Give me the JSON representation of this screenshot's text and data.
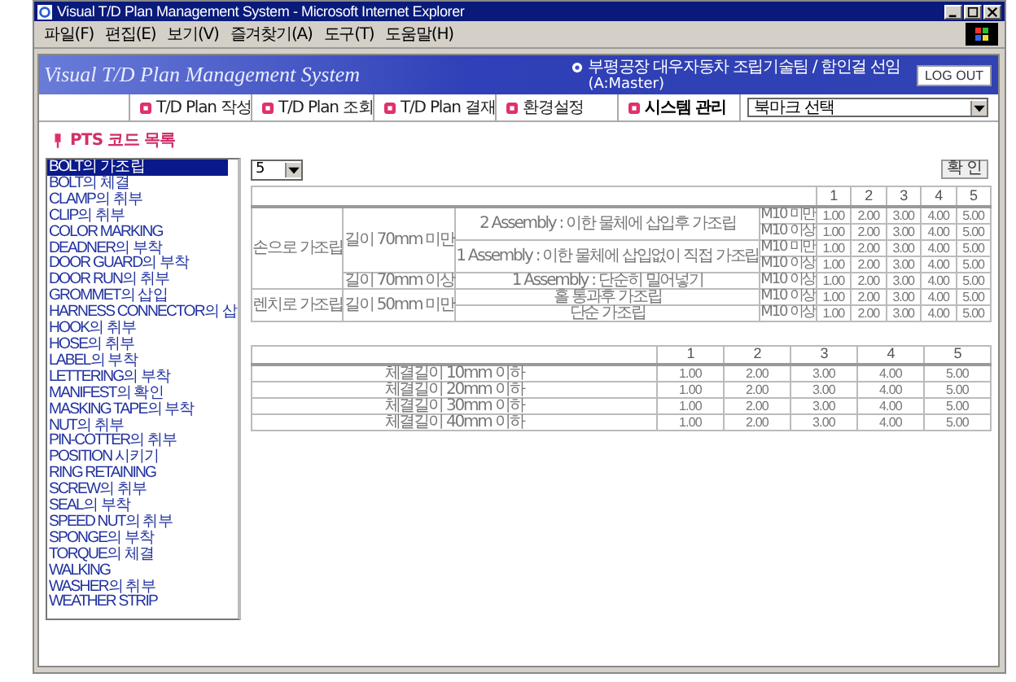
{
  "window": {
    "title": "Visual T/D Plan Management System - Microsoft Internet Explorer"
  },
  "menu": [
    "파일(F)",
    "편집(E)",
    "보기(V)",
    "즐겨찾기(A)",
    "도구(T)",
    "도움말(H)"
  ],
  "header": {
    "app_title": "Visual T/D Plan Management System",
    "user": "부평공장 대우자동차 조립기술팀 / 함인걸 선임",
    "role": "(A:Master)",
    "logout": "LOG OUT"
  },
  "nav": [
    {
      "label": "T/D Plan 작성",
      "selected": false
    },
    {
      "label": "T/D Plan 조회",
      "selected": false
    },
    {
      "label": "T/D Plan 결재",
      "selected": false
    },
    {
      "label": "환경설정",
      "selected": false
    },
    {
      "label": "시스템 관리",
      "selected": true
    }
  ],
  "bookmark": {
    "value": "북마크 선택"
  },
  "section_title": "PTS 코드 목록",
  "codes": [
    {
      "label": "BOLT의 가조립",
      "selected": true
    },
    {
      "label": "BOLT의 체결",
      "selected": false
    },
    {
      "label": "CLAMP의 취부",
      "selected": false
    },
    {
      "label": "CLIP의 취부",
      "selected": false
    },
    {
      "label": "COLOR MARKING",
      "selected": false
    },
    {
      "label": "DEADNER의 부착",
      "selected": false
    },
    {
      "label": "DOOR GUARD의 부착",
      "selected": false
    },
    {
      "label": "DOOR RUN의 취부",
      "selected": false
    },
    {
      "label": "GROMMET의 삽입",
      "selected": false
    },
    {
      "label": "HARNESS CONNECTOR의 삽",
      "selected": false
    },
    {
      "label": "HOOK의 취부",
      "selected": false
    },
    {
      "label": "HOSE의 취부",
      "selected": false
    },
    {
      "label": "LABEL의 부착",
      "selected": false
    },
    {
      "label": "LETTERING의 부착",
      "selected": false
    },
    {
      "label": "MANIFEST의 확인",
      "selected": false
    },
    {
      "label": "MASKING TAPE의 부착",
      "selected": false
    },
    {
      "label": "NUT의 취부",
      "selected": false
    },
    {
      "label": "PIN-COTTER의 취부",
      "selected": false
    },
    {
      "label": "POSITION 시키기",
      "selected": false
    },
    {
      "label": "RING RETAINING",
      "selected": false
    },
    {
      "label": "SCREW의 취부",
      "selected": false
    },
    {
      "label": "SEAL의 부착",
      "selected": false
    },
    {
      "label": "SPEED NUT의 취부",
      "selected": false
    },
    {
      "label": "SPONGE의 부착",
      "selected": false
    },
    {
      "label": "TORQUE의 체결",
      "selected": false
    },
    {
      "label": "WALKING",
      "selected": false
    },
    {
      "label": "WASHER의 취부",
      "selected": false
    },
    {
      "label": "WEATHER STRIP",
      "selected": false
    }
  ],
  "count_select": {
    "value": "5"
  },
  "confirm_button": "확 인",
  "table1": {
    "columns": [
      "1",
      "2",
      "3",
      "4",
      "5"
    ],
    "groups": [
      {
        "label": "손으로 가조립",
        "lengths": [
          {
            "label": "길이 70mm 미만",
            "assemblies": [
              {
                "label": "2 Assembly : 이한 물체에 삽입후 가조립",
                "rows": [
                  {
                    "size": "M10 미만",
                    "values": [
                      "1.00",
                      "2.00",
                      "3.00",
                      "4.00",
                      "5.00"
                    ]
                  },
                  {
                    "size": "M10 이상",
                    "values": [
                      "1.00",
                      "2.00",
                      "3.00",
                      "4.00",
                      "5.00"
                    ]
                  }
                ]
              },
              {
                "label": "1 Assembly : 이한 물체에 삽입없이 직접 가조립",
                "rows": [
                  {
                    "size": "M10 미만",
                    "values": [
                      "1.00",
                      "2.00",
                      "3.00",
                      "4.00",
                      "5.00"
                    ]
                  },
                  {
                    "size": "M10 이상",
                    "values": [
                      "1.00",
                      "2.00",
                      "3.00",
                      "4.00",
                      "5.00"
                    ]
                  }
                ]
              }
            ]
          },
          {
            "label": "길이 70mm 이상",
            "assemblies": [
              {
                "label": "1 Assembly : 단순히 밀어넣기",
                "rows": [
                  {
                    "size": "M10 이상",
                    "values": [
                      "1.00",
                      "2.00",
                      "3.00",
                      "4.00",
                      "5.00"
                    ]
                  }
                ]
              }
            ]
          }
        ]
      },
      {
        "label": "렌치로 가조립",
        "lengths": [
          {
            "label": "길이 50mm 미만",
            "assemblies": [
              {
                "label": "홀 통과후 가조립",
                "rows": [
                  {
                    "size": "M10 이상",
                    "values": [
                      "1.00",
                      "2.00",
                      "3.00",
                      "4.00",
                      "5.00"
                    ]
                  }
                ]
              },
              {
                "label": "단순 가조립",
                "rows": [
                  {
                    "size": "M10 이상",
                    "values": [
                      "1.00",
                      "2.00",
                      "3.00",
                      "4.00",
                      "5.00"
                    ]
                  }
                ]
              }
            ]
          }
        ]
      }
    ]
  },
  "table2": {
    "columns": [
      "1",
      "2",
      "3",
      "4",
      "5"
    ],
    "rows": [
      {
        "label": "체결길이 10mm 이하",
        "values": [
          "1.00",
          "2.00",
          "3.00",
          "4.00",
          "5.00"
        ]
      },
      {
        "label": "체결길이 20mm 이하",
        "values": [
          "1.00",
          "2.00",
          "3.00",
          "4.00",
          "5.00"
        ]
      },
      {
        "label": "체결길이 30mm 이하",
        "values": [
          "1.00",
          "2.00",
          "3.00",
          "4.00",
          "5.00"
        ]
      },
      {
        "label": "체결길이 40mm 이하",
        "values": [
          "1.00",
          "2.00",
          "3.00",
          "4.00",
          "5.00"
        ]
      }
    ]
  }
}
